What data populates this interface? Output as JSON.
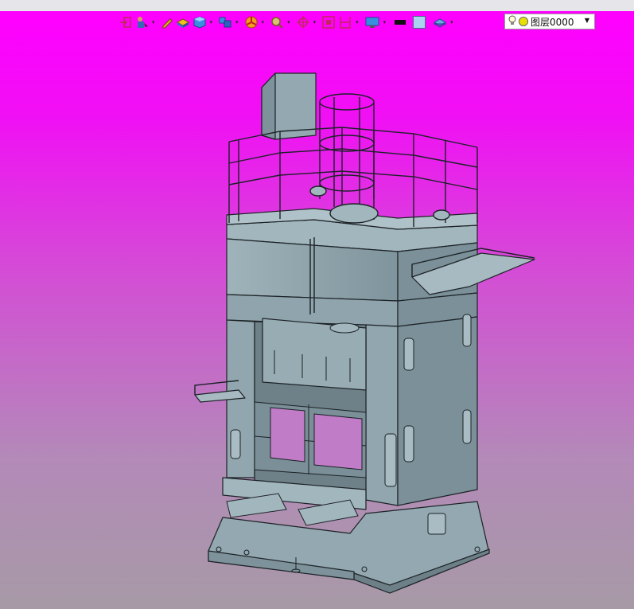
{
  "toolbar": {
    "layer_label": "图层0000",
    "icons": [
      "exit-icon",
      "select-icon",
      "pencil-icon",
      "box-icon",
      "cube-icon",
      "multi-cube-icon",
      "color-wheel-icon",
      "zoom-icon",
      "move-icon",
      "fit-icon",
      "section-icon",
      "display-icon",
      "line-color-swatch",
      "fill-color-swatch",
      "layer-stack-icon",
      "bulb-icon",
      "layer-color-dot"
    ]
  },
  "colors": {
    "background_top": "#ff00ff",
    "background_bottom": "#a79aa6",
    "model_fill": "#8fa4ac",
    "model_edge": "#1c2226"
  }
}
